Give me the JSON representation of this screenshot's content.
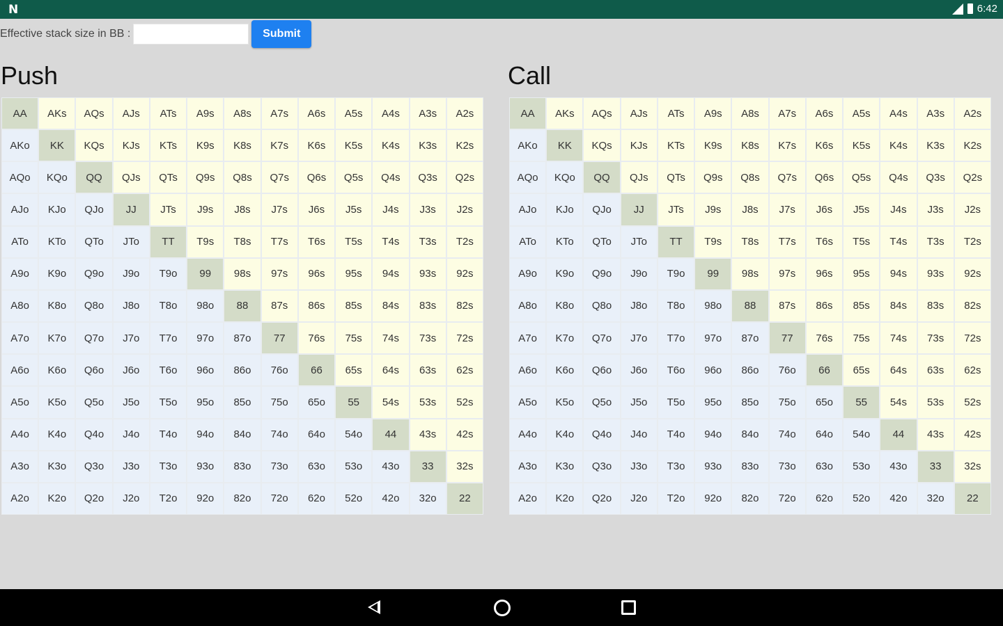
{
  "statusbar": {
    "app_icon": "N",
    "time": "6:42",
    "icons": [
      "signal-icon",
      "battery-icon"
    ]
  },
  "form": {
    "label": "Effective stack size in BB :",
    "input_value": "",
    "submit_label": "Submit"
  },
  "push": {
    "title": "Push",
    "rows": [
      [
        "AA",
        "AKs",
        "AQs",
        "AJs",
        "ATs",
        "A9s",
        "A8s",
        "A7s",
        "A6s",
        "A5s",
        "A4s",
        "A3s",
        "A2s"
      ],
      [
        "AKo",
        "KK",
        "KQs",
        "KJs",
        "KTs",
        "K9s",
        "K8s",
        "K7s",
        "K6s",
        "K5s",
        "K4s",
        "K3s",
        "K2s"
      ],
      [
        "AQo",
        "KQo",
        "QQ",
        "QJs",
        "QTs",
        "Q9s",
        "Q8s",
        "Q7s",
        "Q6s",
        "Q5s",
        "Q4s",
        "Q3s",
        "Q2s"
      ],
      [
        "AJo",
        "KJo",
        "QJo",
        "JJ",
        "JTs",
        "J9s",
        "J8s",
        "J7s",
        "J6s",
        "J5s",
        "J4s",
        "J3s",
        "J2s"
      ],
      [
        "ATo",
        "KTo",
        "QTo",
        "JTo",
        "TT",
        "T9s",
        "T8s",
        "T7s",
        "T6s",
        "T5s",
        "T4s",
        "T3s",
        "T2s"
      ],
      [
        "A9o",
        "K9o",
        "Q9o",
        "J9o",
        "T9o",
        "99",
        "98s",
        "97s",
        "96s",
        "95s",
        "94s",
        "93s",
        "92s"
      ],
      [
        "A8o",
        "K8o",
        "Q8o",
        "J8o",
        "T8o",
        "98o",
        "88",
        "87s",
        "86s",
        "85s",
        "84s",
        "83s",
        "82s"
      ],
      [
        "A7o",
        "K7o",
        "Q7o",
        "J7o",
        "T7o",
        "97o",
        "87o",
        "77",
        "76s",
        "75s",
        "74s",
        "73s",
        "72s"
      ],
      [
        "A6o",
        "K6o",
        "Q6o",
        "J6o",
        "T6o",
        "96o",
        "86o",
        "76o",
        "66",
        "65s",
        "64s",
        "63s",
        "62s"
      ],
      [
        "A5o",
        "K5o",
        "Q5o",
        "J5o",
        "T5o",
        "95o",
        "85o",
        "75o",
        "65o",
        "55",
        "54s",
        "53s",
        "52s"
      ],
      [
        "A4o",
        "K4o",
        "Q4o",
        "J4o",
        "T4o",
        "94o",
        "84o",
        "74o",
        "64o",
        "54o",
        "44",
        "43s",
        "42s"
      ],
      [
        "A3o",
        "K3o",
        "Q3o",
        "J3o",
        "T3o",
        "93o",
        "83o",
        "73o",
        "63o",
        "53o",
        "43o",
        "33",
        "32s"
      ],
      [
        "A2o",
        "K2o",
        "Q2o",
        "J2o",
        "T2o",
        "92o",
        "82o",
        "72o",
        "62o",
        "52o",
        "42o",
        "32o",
        "22"
      ]
    ]
  },
  "call": {
    "title": "Call",
    "rows": [
      [
        "AA",
        "AKs",
        "AQs",
        "AJs",
        "ATs",
        "A9s",
        "A8s",
        "A7s",
        "A6s",
        "A5s",
        "A4s",
        "A3s",
        "A2s"
      ],
      [
        "AKo",
        "KK",
        "KQs",
        "KJs",
        "KTs",
        "K9s",
        "K8s",
        "K7s",
        "K6s",
        "K5s",
        "K4s",
        "K3s",
        "K2s"
      ],
      [
        "AQo",
        "KQo",
        "QQ",
        "QJs",
        "QTs",
        "Q9s",
        "Q8s",
        "Q7s",
        "Q6s",
        "Q5s",
        "Q4s",
        "Q3s",
        "Q2s"
      ],
      [
        "AJo",
        "KJo",
        "QJo",
        "JJ",
        "JTs",
        "J9s",
        "J8s",
        "J7s",
        "J6s",
        "J5s",
        "J4s",
        "J3s",
        "J2s"
      ],
      [
        "ATo",
        "KTo",
        "QTo",
        "JTo",
        "TT",
        "T9s",
        "T8s",
        "T7s",
        "T6s",
        "T5s",
        "T4s",
        "T3s",
        "T2s"
      ],
      [
        "A9o",
        "K9o",
        "Q9o",
        "J9o",
        "T9o",
        "99",
        "98s",
        "97s",
        "96s",
        "95s",
        "94s",
        "93s",
        "92s"
      ],
      [
        "A8o",
        "K8o",
        "Q8o",
        "J8o",
        "T8o",
        "98o",
        "88",
        "87s",
        "86s",
        "85s",
        "84s",
        "83s",
        "82s"
      ],
      [
        "A7o",
        "K7o",
        "Q7o",
        "J7o",
        "T7o",
        "97o",
        "87o",
        "77",
        "76s",
        "75s",
        "74s",
        "73s",
        "72s"
      ],
      [
        "A6o",
        "K6o",
        "Q6o",
        "J6o",
        "T6o",
        "96o",
        "86o",
        "76o",
        "66",
        "65s",
        "64s",
        "63s",
        "62s"
      ],
      [
        "A5o",
        "K5o",
        "Q5o",
        "J5o",
        "T5o",
        "95o",
        "85o",
        "75o",
        "65o",
        "55",
        "54s",
        "53s",
        "52s"
      ],
      [
        "A4o",
        "K4o",
        "Q4o",
        "J4o",
        "T4o",
        "94o",
        "84o",
        "74o",
        "64o",
        "54o",
        "44",
        "43s",
        "42s"
      ],
      [
        "A3o",
        "K3o",
        "Q3o",
        "J3o",
        "T3o",
        "93o",
        "83o",
        "73o",
        "63o",
        "53o",
        "43o",
        "33",
        "32s"
      ],
      [
        "A2o",
        "K2o",
        "Q2o",
        "J2o",
        "T2o",
        "92o",
        "82o",
        "72o",
        "62o",
        "52o",
        "42o",
        "32o",
        "22"
      ]
    ]
  },
  "colors": {
    "statusbar": "#0f5b4a",
    "suited": "#fdfde3",
    "offsuit": "#e9f0f9",
    "pair": "#d4dcc8",
    "submit": "#1e80f0"
  },
  "navbar": {
    "buttons": [
      "back-icon",
      "home-icon",
      "recents-icon"
    ]
  }
}
